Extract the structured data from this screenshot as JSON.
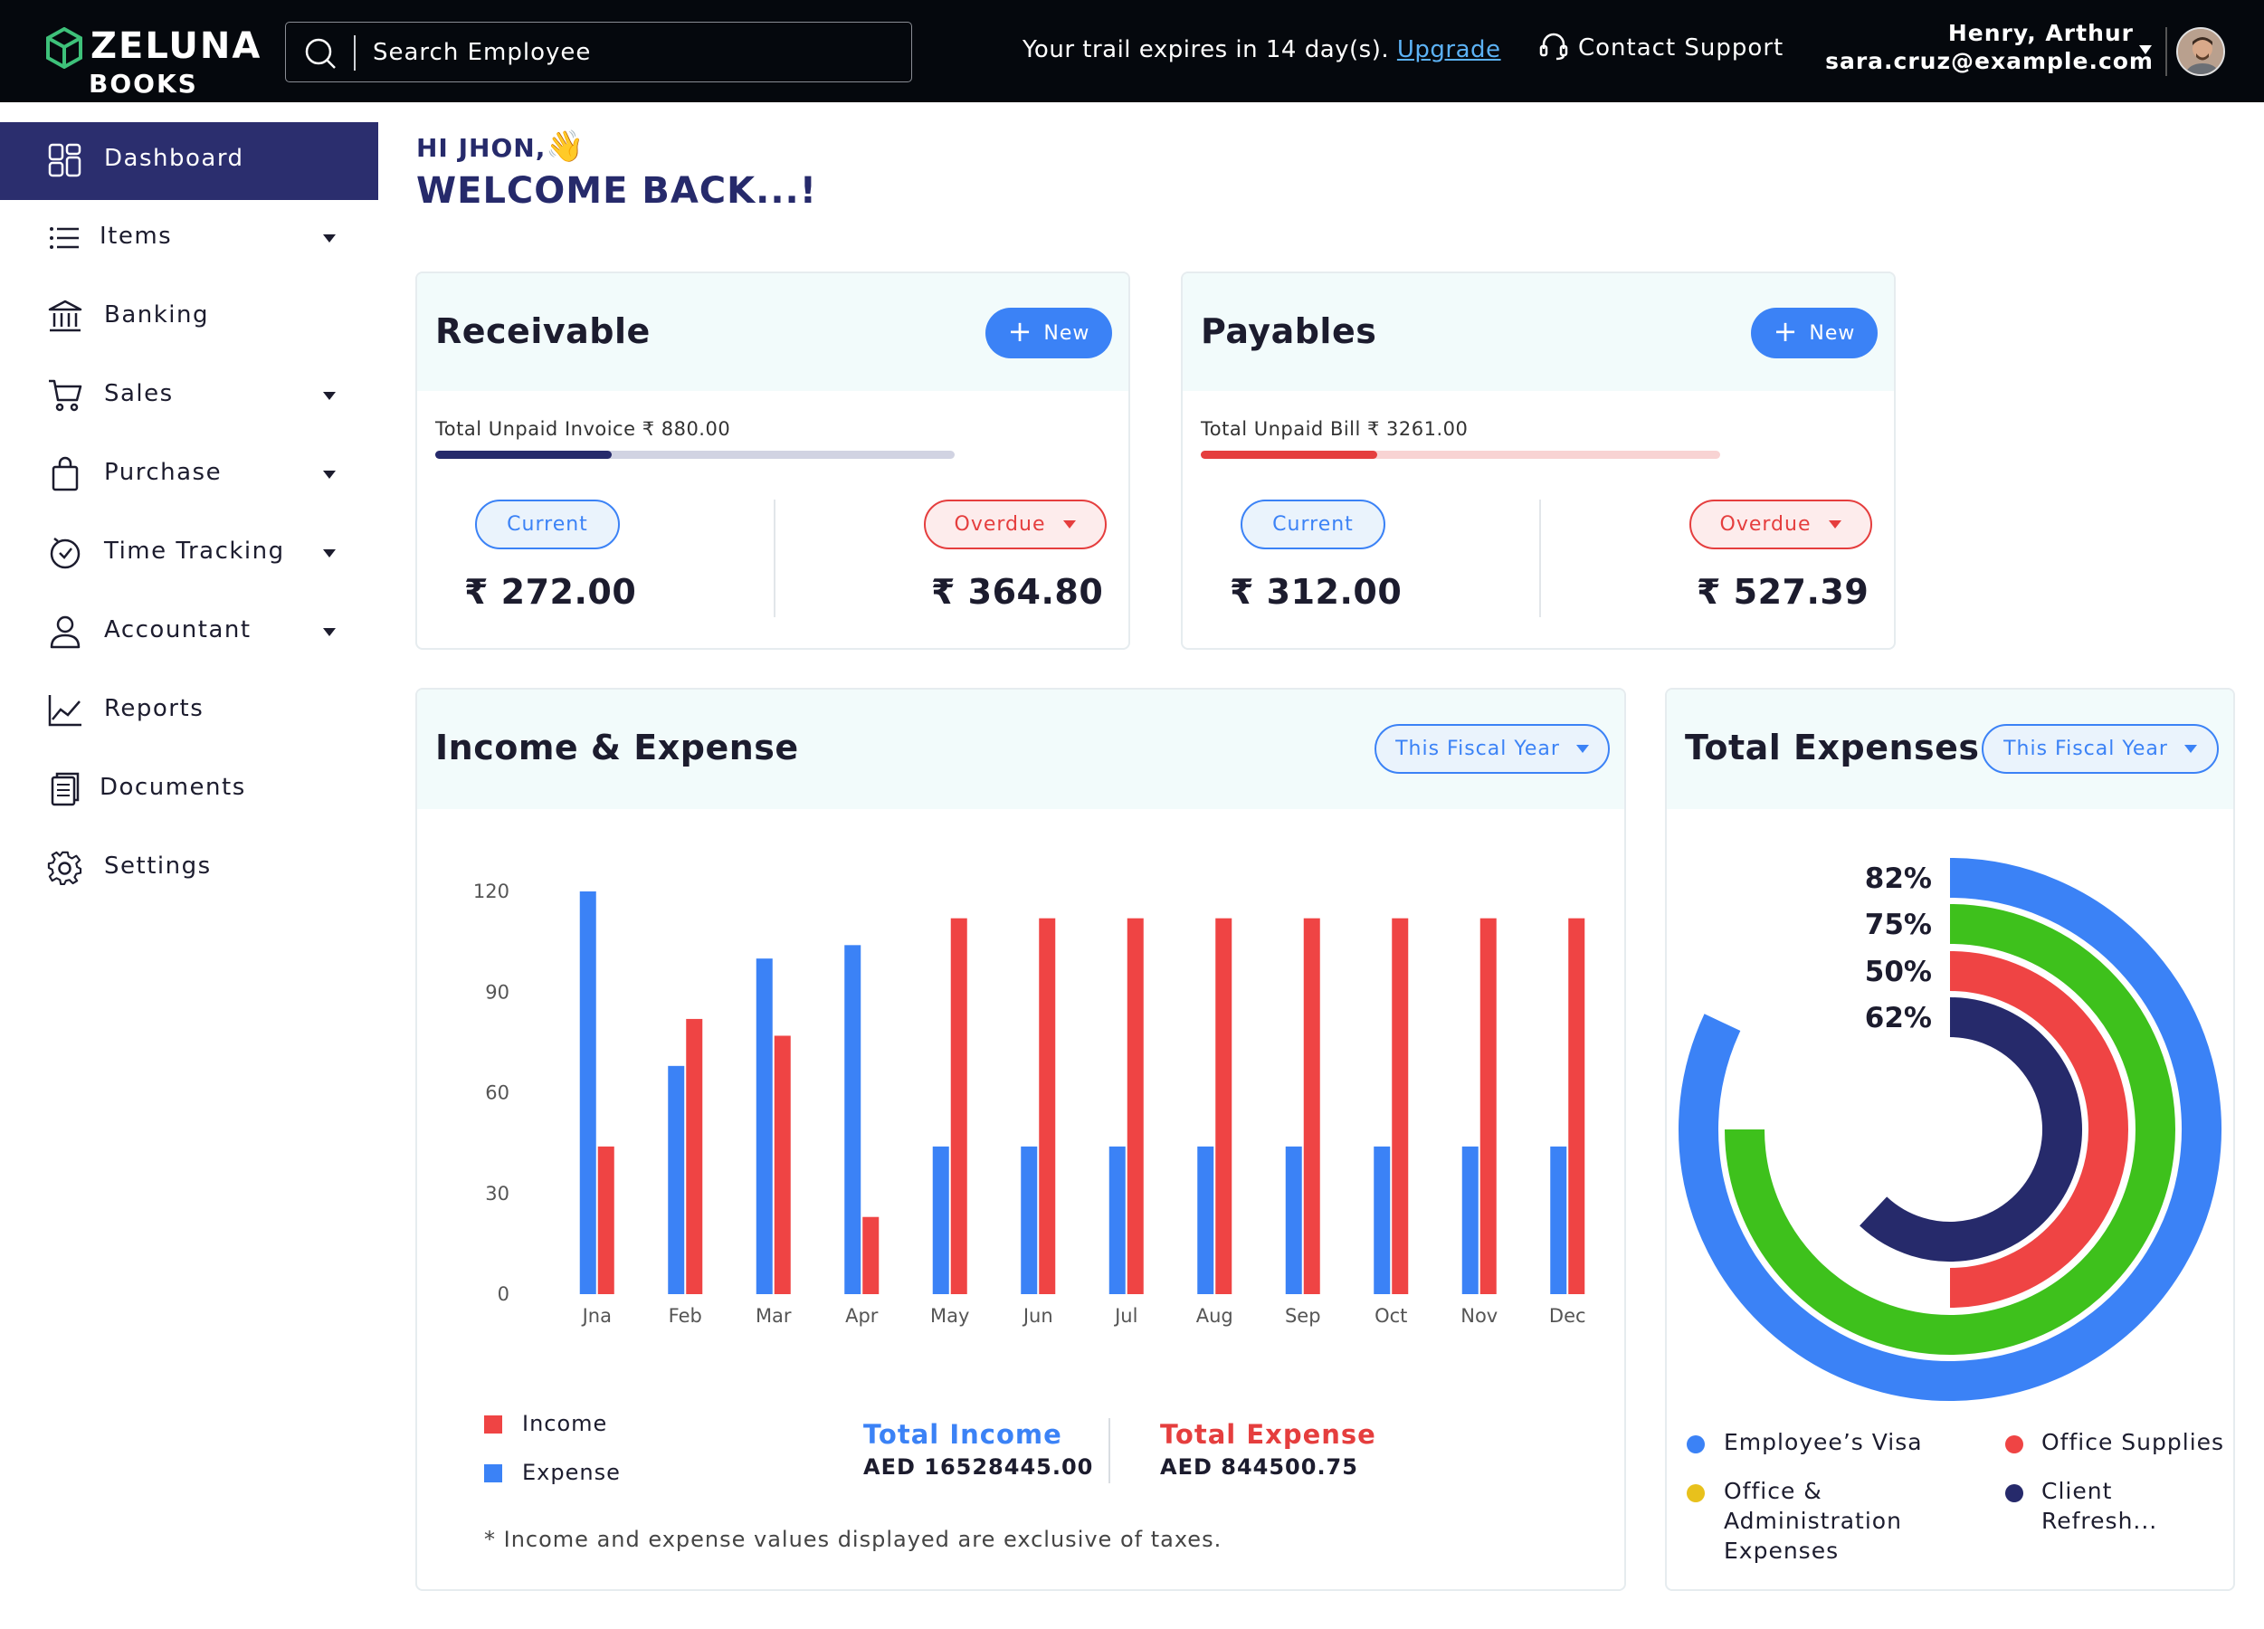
{
  "header": {
    "brand": "ZELUNA",
    "brand_sub": "BOOKS",
    "search_placeholder": "Search Employee",
    "trial_text": "Your trail expires in 14 day(s).",
    "upgrade_label": "Upgrade",
    "support_label": "Contact Support",
    "user_name": "Henry, Arthur",
    "user_email": "sara.cruz@example.com"
  },
  "sidebar": {
    "items": [
      {
        "label": "Dashboard",
        "icon": "dashboard-icon",
        "active": true
      },
      {
        "label": "Items",
        "icon": "list-icon",
        "dropdown": true
      },
      {
        "label": "Banking",
        "icon": "bank-icon"
      },
      {
        "label": "Sales",
        "icon": "cart-icon",
        "dropdown": true
      },
      {
        "label": "Purchase",
        "icon": "bag-icon",
        "dropdown": true
      },
      {
        "label": "Time Tracking",
        "icon": "clock-icon",
        "dropdown": true
      },
      {
        "label": "Accountant",
        "icon": "user-icon",
        "dropdown": true
      },
      {
        "label": "Reports",
        "icon": "chart-line-icon"
      },
      {
        "label": "Documents",
        "icon": "document-icon"
      },
      {
        "label": "Settings",
        "icon": "gear-icon"
      }
    ]
  },
  "greeting": {
    "line1": "HI JHON,",
    "emoji": "👋",
    "line2": "WELCOME BACK...!"
  },
  "receivable": {
    "title": "Receivable",
    "new_label": "New",
    "unpaid_text": "Total Unpaid Invoice ₹ 880.00",
    "progress": 0.34,
    "current_label": "Current",
    "overdue_label": "Overdue",
    "current_amount": "₹ 272.00",
    "overdue_amount": "₹ 364.80",
    "accent": "#262a6b",
    "track": "#d1d3e2"
  },
  "payables": {
    "title": "Payables",
    "new_label": "New",
    "unpaid_text": "Total Unpaid Bill ₹ 3261.00",
    "progress": 0.34,
    "current_label": "Current",
    "overdue_label": "Overdue",
    "current_amount": "₹ 312.00",
    "overdue_amount": "₹ 527.39",
    "accent": "#e53e3e",
    "track": "#f8d3d3"
  },
  "income_expense": {
    "title": "Income & Expense",
    "filter_label": "This Fiscal Year",
    "legend_income": "Income",
    "legend_expense": "Expense",
    "total_income_label": "Total Income",
    "total_income_value": "AED 16528445.00",
    "total_expense_label": "Total Expense",
    "total_expense_value": "AED 844500.75",
    "note": "* Income and expense values displayed are exclusive of taxes."
  },
  "total_expenses": {
    "title": "Total Expenses",
    "filter_label": "This Fiscal Year",
    "legend": [
      {
        "label": "Employee’s Visa",
        "color": "#3b82f6"
      },
      {
        "label": "Office Supplies",
        "color": "#ef4444"
      },
      {
        "label": "Office & Administration Expenses",
        "color": "#e8c11c"
      },
      {
        "label": "Client Refresh...",
        "color": "#262a6b"
      }
    ]
  },
  "chart_data": [
    {
      "type": "bar",
      "title": "Income & Expense",
      "categories": [
        "Jna",
        "Feb",
        "Mar",
        "Apr",
        "May",
        "Jun",
        "Jul",
        "Aug",
        "Sep",
        "Oct",
        "Nov",
        "Dec"
      ],
      "series": [
        {
          "name": "Expense",
          "color": "#3b82f6",
          "values": [
            120,
            68,
            100,
            104,
            44,
            44,
            44,
            44,
            44,
            44,
            44,
            44
          ]
        },
        {
          "name": "Income",
          "color": "#ef4444",
          "values": [
            44,
            82,
            77,
            23,
            112,
            112,
            112,
            112,
            112,
            112,
            112,
            112
          ]
        }
      ],
      "yticks": [
        0,
        30,
        60,
        90,
        120
      ],
      "ylim": [
        0,
        120
      ],
      "grid": false
    },
    {
      "type": "radial-bar",
      "title": "Total Expenses",
      "rings": [
        {
          "label": "82%",
          "value": 82,
          "color": "#3b82f6"
        },
        {
          "label": "75%",
          "value": 75,
          "color": "#3ec11c"
        },
        {
          "label": "50%",
          "value": 50,
          "color": "#ef4444"
        },
        {
          "label": "62%",
          "value": 62,
          "color": "#262a6b"
        }
      ]
    }
  ]
}
